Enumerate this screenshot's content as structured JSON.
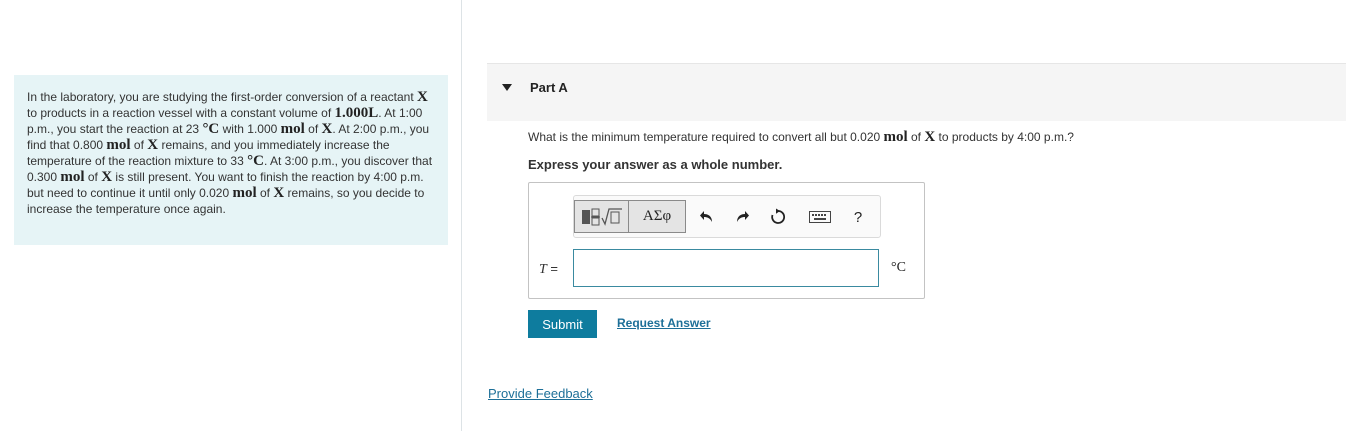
{
  "intro": {
    "segments": [
      {
        "t": "In the laboratory, you are studying the first-order conversion of a reactant ",
        "math": false
      },
      {
        "t": "X",
        "math": true
      },
      {
        "t": " to products in a reaction vessel with a constant volume of ",
        "math": false
      },
      {
        "t": "1.000L",
        "math": true
      },
      {
        "t": ". At 1:00 p.m., you start the reaction at 23 ",
        "math": false
      },
      {
        "t": "°C",
        "math": true
      },
      {
        "t": " with 1.000 ",
        "math": false
      },
      {
        "t": "mol",
        "math": true
      },
      {
        "t": " of ",
        "math": false
      },
      {
        "t": "X",
        "math": true
      },
      {
        "t": ". At 2:00 p.m., you find that 0.800 ",
        "math": false
      },
      {
        "t": "mol",
        "math": true
      },
      {
        "t": " of ",
        "math": false
      },
      {
        "t": "X",
        "math": true
      },
      {
        "t": " remains, and you immediately increase the temperature of the reaction mixture to 33 ",
        "math": false
      },
      {
        "t": "°C",
        "math": true
      },
      {
        "t": ". At 3:00 p.m., you discover that 0.300 ",
        "math": false
      },
      {
        "t": "mol",
        "math": true
      },
      {
        "t": " of ",
        "math": false
      },
      {
        "t": "X",
        "math": true
      },
      {
        "t": " is still present. You want to finish the reaction by 4:00 p.m. but need to continue it until only 0.020 ",
        "math": false
      },
      {
        "t": "mol",
        "math": true
      },
      {
        "t": " of ",
        "math": false
      },
      {
        "t": "X",
        "math": true
      },
      {
        "t": " remains, so you decide to increase the temperature once again.",
        "math": false
      }
    ]
  },
  "part": {
    "title": "Part A",
    "question": {
      "before": "What is the minimum temperature required to convert all but 0.020 ",
      "mol": "mol",
      "of": " of ",
      "x": "X",
      "after": " to products by 4:00 p.m.?"
    },
    "instruction": "Express your answer as a whole number."
  },
  "toolbar": {
    "greek_label": "ΑΣφ",
    "help_label": "?",
    "icons": [
      "templates-icon",
      "greek-symbols-icon",
      "undo-icon",
      "redo-icon",
      "reset-icon",
      "keyboard-icon",
      "help-icon"
    ]
  },
  "answer": {
    "variable": "T",
    "equals": " =",
    "value": "",
    "unit": "°C"
  },
  "actions": {
    "submit": "Submit",
    "request_answer": "Request Answer",
    "provide_feedback": "Provide Feedback"
  },
  "colors": {
    "intro_bg": "#e6f4f6",
    "submit_bg": "#0e7c9e",
    "link": "#1d6f98",
    "input_border": "#3a8aa0"
  }
}
